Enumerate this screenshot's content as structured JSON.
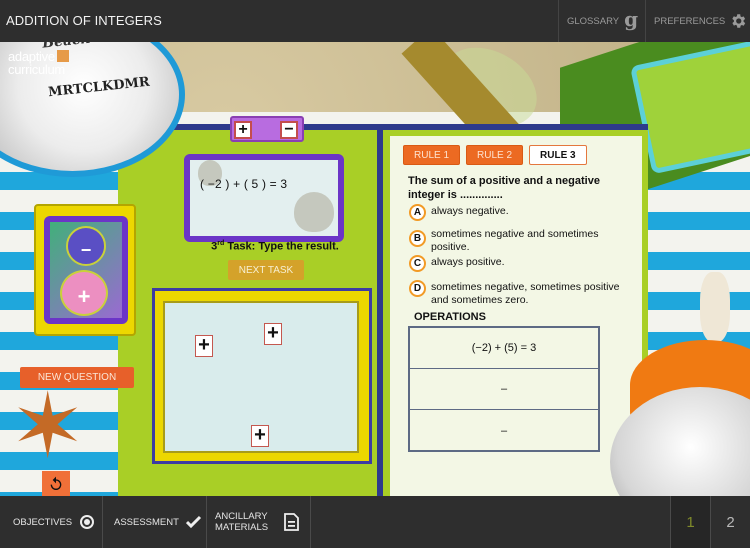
{
  "header": {
    "title": "ADDITION OF INTEGERS",
    "glossary_label": "GLOSSARY",
    "glossary_icon": "g",
    "preferences_label": "PREFERENCES"
  },
  "branding": {
    "logo_line1": "adaptive",
    "logo_line2": "curriculum",
    "ball_text1": "Beach Classic",
    "ball_text2": "MRTCLKDMR"
  },
  "workspace": {
    "toggle_plus": "+",
    "toggle_minus": "−",
    "equation": "( −2 ) + ( 5 ) = 3",
    "task_ordinal": "3",
    "task_ordinal_suffix": "rd",
    "task_text": " Task: Type the result.",
    "next_task_label": "NEXT TASK",
    "tiles": [
      "+",
      "+",
      "+"
    ]
  },
  "card": {
    "minus_symbol": "−",
    "plus_symbol": "+"
  },
  "left_controls": {
    "new_question_label": "NEW QUESTION"
  },
  "rules": {
    "tabs": [
      {
        "label": "RULE 1",
        "active": false
      },
      {
        "label": "RULE 2",
        "active": false
      },
      {
        "label": "RULE 3",
        "active": true
      }
    ],
    "question": "The sum of a positive and a negative integer is ..............",
    "options": [
      {
        "letter": "A",
        "text": "always negative."
      },
      {
        "letter": "B",
        "text": "sometimes negative and sometimes positive."
      },
      {
        "letter": "C",
        "text": "always positive."
      },
      {
        "letter": "D",
        "text": "sometimes negative, sometimes positive and sometimes zero."
      }
    ],
    "operations_title": "OPERATIONS",
    "operations": [
      "(−2) + (5) = 3",
      "–",
      "–"
    ]
  },
  "footer": {
    "objectives_label": "OBJECTIVES",
    "assessment_label": "ASSESSMENT",
    "ancillary_line1": "ANCILLARY",
    "ancillary_line2": "MATERIALS",
    "pages": [
      "1",
      "2"
    ],
    "current_page": "1"
  },
  "colors": {
    "accent_orange": "#ec6a22",
    "board_green": "#a9cf26",
    "frame_purple": "#6b35c7",
    "bar_dark": "#2e2e2e"
  }
}
